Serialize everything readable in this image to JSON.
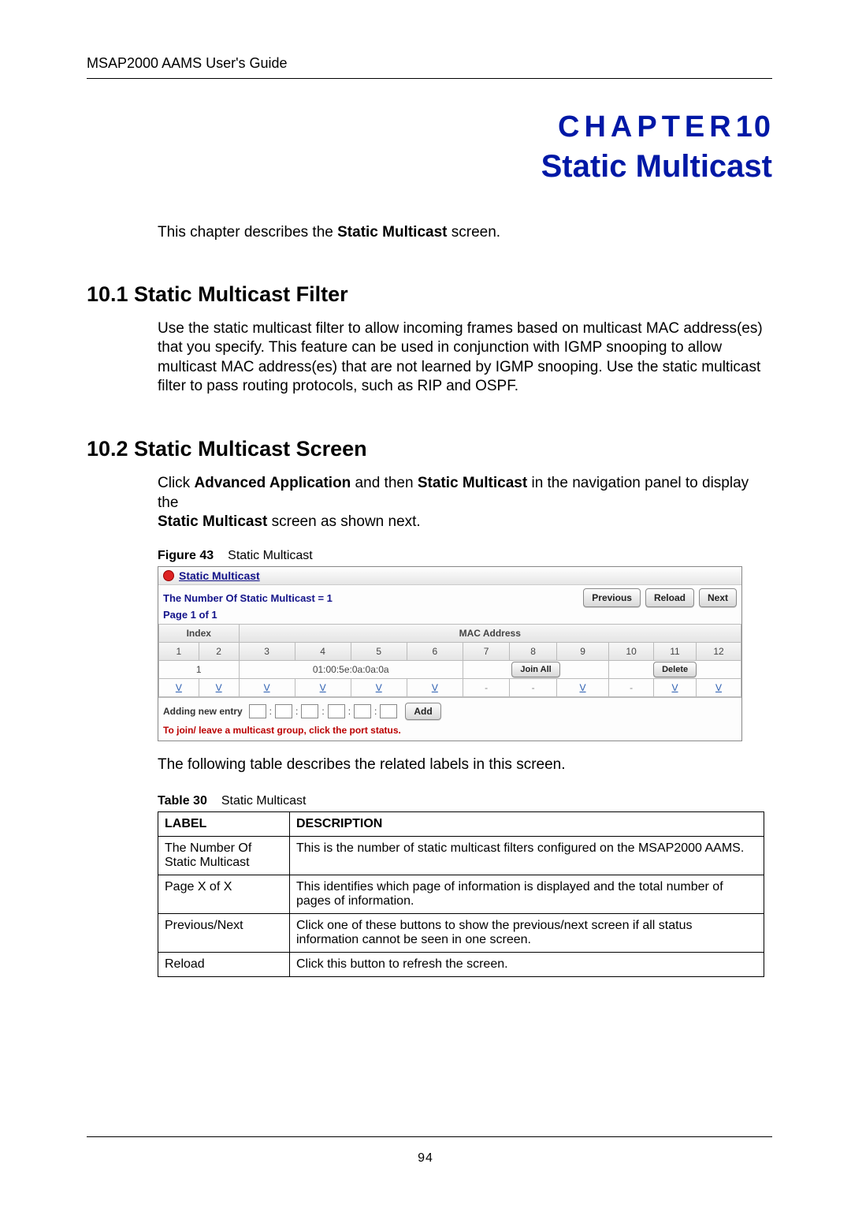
{
  "running_head": "MSAP2000 AAMS User's Guide",
  "chapter": {
    "label": "CHAPTER",
    "number": "10",
    "title": "Static Multicast"
  },
  "intro": {
    "prefix": "This chapter describes the ",
    "bold": "Static Multicast",
    "suffix": " screen."
  },
  "section1": {
    "heading": "10.1  Static Multicast Filter",
    "body": "Use the static multicast filter to allow incoming frames based on multicast MAC address(es) that you specify. This feature can be used in conjunction with IGMP snooping to allow multicast MAC address(es) that are not learned by IGMP snooping. Use the static multicast filter to pass routing protocols, such as RIP and OSPF."
  },
  "section2": {
    "heading": "10.2  Static Multicast Screen",
    "line1_pre": "Click ",
    "line1_b1": "Advanced Application",
    "line1_mid": " and then ",
    "line1_b2": "Static Multicast",
    "line1_post": " in the navigation panel to display the",
    "line2_b": "Static Multicast",
    "line2_post": " screen as shown next."
  },
  "figure": {
    "caption_label": "Figure 43",
    "caption_text": "Static Multicast",
    "window_title": "Static Multicast",
    "count_line": "The Number Of Static Multicast  =  1",
    "page_line": "Page   1  of  1",
    "buttons": {
      "previous": "Previous",
      "reload": "Reload",
      "next": "Next"
    },
    "headers": {
      "index": "Index",
      "mac": "MAC Address"
    },
    "cols": [
      "1",
      "2",
      "3",
      "4",
      "5",
      "6",
      "7",
      "8",
      "9",
      "10",
      "11",
      "12"
    ],
    "row": {
      "index": "1",
      "mac": "01:00:5e:0a:0a:0a",
      "join_all": "Join All",
      "delete": "Delete"
    },
    "status": [
      "V",
      "V",
      "V",
      "V",
      "V",
      "V",
      "-",
      "-",
      "V",
      "-",
      "V",
      "V"
    ],
    "add_label": "Adding new entry",
    "add_button": "Add",
    "note": "To join/ leave a multicast group,  click the port status."
  },
  "after_figure": "The following table describes the related labels in this screen.",
  "table": {
    "caption_label": "Table 30",
    "caption_text": "Static Multicast",
    "head": {
      "label": "LABEL",
      "desc": "DESCRIPTION"
    },
    "rows": [
      {
        "label": "The Number Of Static Multicast",
        "desc": "This is the number of static multicast filters configured on the MSAP2000 AAMS."
      },
      {
        "label": "Page X of X",
        "desc": "This identifies which page of information is displayed and the total number of pages of information."
      },
      {
        "label": "Previous/Next",
        "desc": "Click one of these buttons to show the previous/next screen if all status information cannot be seen in one screen."
      },
      {
        "label": "Reload",
        "desc": "Click this button to refresh the screen."
      }
    ]
  },
  "page_number": "94"
}
